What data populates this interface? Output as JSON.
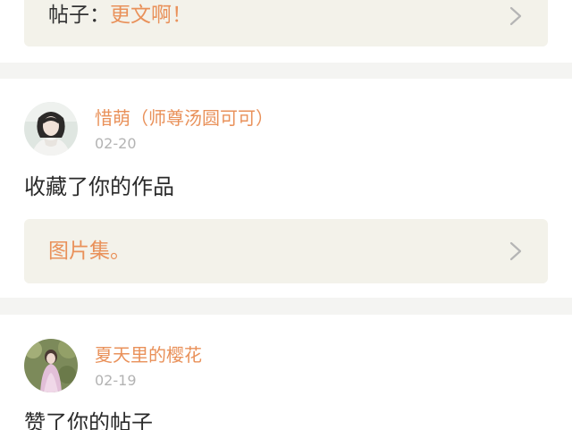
{
  "notifications": [
    {
      "ref_prefix": "帖子：",
      "ref_title": "更文啊！"
    },
    {
      "username": "惜萌（师尊汤圆可可）",
      "date": "02-20",
      "action": "收藏了你的作品",
      "ref_title": "图片集。"
    },
    {
      "username": "夏天里的樱花",
      "date": "02-19",
      "action": "赞了你的帖子"
    }
  ],
  "icons": {
    "avatar_1": "user-avatar",
    "avatar_2": "user-avatar",
    "chevron": "chevron-right-icon"
  },
  "colors": {
    "accent": "#e9915a",
    "background": "#f4f4f2",
    "card": "#ffffff",
    "ref_box": "#f3f2ea",
    "muted": "#b3b3b3"
  }
}
